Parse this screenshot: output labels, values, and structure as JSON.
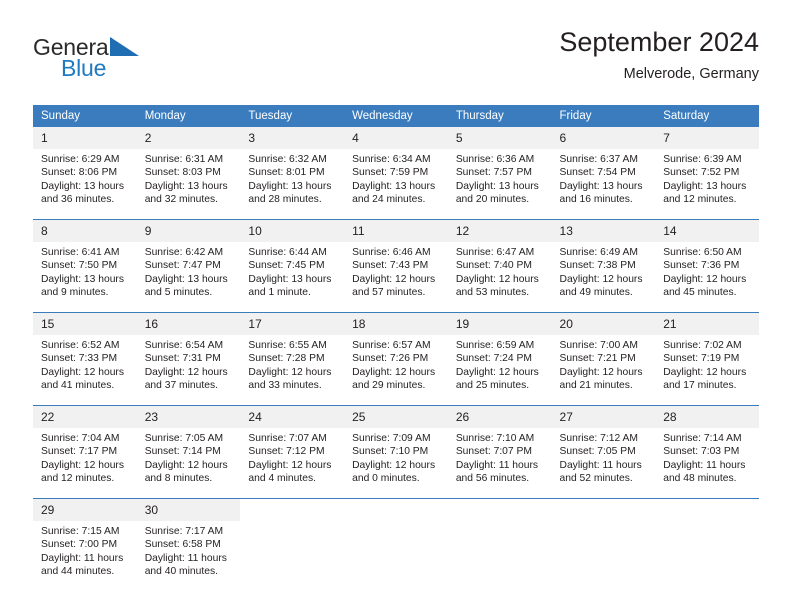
{
  "brand": {
    "name_part1": "General",
    "name_part2": "Blue",
    "triangle_color": "#1f6eb4",
    "blue_color": "#1f7bc1"
  },
  "header": {
    "title": "September 2024",
    "subtitle": "Melverode, Germany",
    "header_bg": "#3a7cbe",
    "daynum_bg": "#f1f1f1"
  },
  "weekday_headers": [
    "Sunday",
    "Monday",
    "Tuesday",
    "Wednesday",
    "Thursday",
    "Friday",
    "Saturday"
  ],
  "labels": {
    "sunrise_prefix": "Sunrise:",
    "sunset_prefix": "Sunset:",
    "daylight_prefix": "Daylight:"
  },
  "weeks": [
    [
      {
        "day": "1",
        "sunrise": "Sunrise: 6:29 AM",
        "sunset": "Sunset: 8:06 PM",
        "daylight_line1": "Daylight: 13 hours",
        "daylight_line2": "and 36 minutes."
      },
      {
        "day": "2",
        "sunrise": "Sunrise: 6:31 AM",
        "sunset": "Sunset: 8:03 PM",
        "daylight_line1": "Daylight: 13 hours",
        "daylight_line2": "and 32 minutes."
      },
      {
        "day": "3",
        "sunrise": "Sunrise: 6:32 AM",
        "sunset": "Sunset: 8:01 PM",
        "daylight_line1": "Daylight: 13 hours",
        "daylight_line2": "and 28 minutes."
      },
      {
        "day": "4",
        "sunrise": "Sunrise: 6:34 AM",
        "sunset": "Sunset: 7:59 PM",
        "daylight_line1": "Daylight: 13 hours",
        "daylight_line2": "and 24 minutes."
      },
      {
        "day": "5",
        "sunrise": "Sunrise: 6:36 AM",
        "sunset": "Sunset: 7:57 PM",
        "daylight_line1": "Daylight: 13 hours",
        "daylight_line2": "and 20 minutes."
      },
      {
        "day": "6",
        "sunrise": "Sunrise: 6:37 AM",
        "sunset": "Sunset: 7:54 PM",
        "daylight_line1": "Daylight: 13 hours",
        "daylight_line2": "and 16 minutes."
      },
      {
        "day": "7",
        "sunrise": "Sunrise: 6:39 AM",
        "sunset": "Sunset: 7:52 PM",
        "daylight_line1": "Daylight: 13 hours",
        "daylight_line2": "and 12 minutes."
      }
    ],
    [
      {
        "day": "8",
        "sunrise": "Sunrise: 6:41 AM",
        "sunset": "Sunset: 7:50 PM",
        "daylight_line1": "Daylight: 13 hours",
        "daylight_line2": "and 9 minutes."
      },
      {
        "day": "9",
        "sunrise": "Sunrise: 6:42 AM",
        "sunset": "Sunset: 7:47 PM",
        "daylight_line1": "Daylight: 13 hours",
        "daylight_line2": "and 5 minutes."
      },
      {
        "day": "10",
        "sunrise": "Sunrise: 6:44 AM",
        "sunset": "Sunset: 7:45 PM",
        "daylight_line1": "Daylight: 13 hours",
        "daylight_line2": "and 1 minute."
      },
      {
        "day": "11",
        "sunrise": "Sunrise: 6:46 AM",
        "sunset": "Sunset: 7:43 PM",
        "daylight_line1": "Daylight: 12 hours",
        "daylight_line2": "and 57 minutes."
      },
      {
        "day": "12",
        "sunrise": "Sunrise: 6:47 AM",
        "sunset": "Sunset: 7:40 PM",
        "daylight_line1": "Daylight: 12 hours",
        "daylight_line2": "and 53 minutes."
      },
      {
        "day": "13",
        "sunrise": "Sunrise: 6:49 AM",
        "sunset": "Sunset: 7:38 PM",
        "daylight_line1": "Daylight: 12 hours",
        "daylight_line2": "and 49 minutes."
      },
      {
        "day": "14",
        "sunrise": "Sunrise: 6:50 AM",
        "sunset": "Sunset: 7:36 PM",
        "daylight_line1": "Daylight: 12 hours",
        "daylight_line2": "and 45 minutes."
      }
    ],
    [
      {
        "day": "15",
        "sunrise": "Sunrise: 6:52 AM",
        "sunset": "Sunset: 7:33 PM",
        "daylight_line1": "Daylight: 12 hours",
        "daylight_line2": "and 41 minutes."
      },
      {
        "day": "16",
        "sunrise": "Sunrise: 6:54 AM",
        "sunset": "Sunset: 7:31 PM",
        "daylight_line1": "Daylight: 12 hours",
        "daylight_line2": "and 37 minutes."
      },
      {
        "day": "17",
        "sunrise": "Sunrise: 6:55 AM",
        "sunset": "Sunset: 7:28 PM",
        "daylight_line1": "Daylight: 12 hours",
        "daylight_line2": "and 33 minutes."
      },
      {
        "day": "18",
        "sunrise": "Sunrise: 6:57 AM",
        "sunset": "Sunset: 7:26 PM",
        "daylight_line1": "Daylight: 12 hours",
        "daylight_line2": "and 29 minutes."
      },
      {
        "day": "19",
        "sunrise": "Sunrise: 6:59 AM",
        "sunset": "Sunset: 7:24 PM",
        "daylight_line1": "Daylight: 12 hours",
        "daylight_line2": "and 25 minutes."
      },
      {
        "day": "20",
        "sunrise": "Sunrise: 7:00 AM",
        "sunset": "Sunset: 7:21 PM",
        "daylight_line1": "Daylight: 12 hours",
        "daylight_line2": "and 21 minutes."
      },
      {
        "day": "21",
        "sunrise": "Sunrise: 7:02 AM",
        "sunset": "Sunset: 7:19 PM",
        "daylight_line1": "Daylight: 12 hours",
        "daylight_line2": "and 17 minutes."
      }
    ],
    [
      {
        "day": "22",
        "sunrise": "Sunrise: 7:04 AM",
        "sunset": "Sunset: 7:17 PM",
        "daylight_line1": "Daylight: 12 hours",
        "daylight_line2": "and 12 minutes."
      },
      {
        "day": "23",
        "sunrise": "Sunrise: 7:05 AM",
        "sunset": "Sunset: 7:14 PM",
        "daylight_line1": "Daylight: 12 hours",
        "daylight_line2": "and 8 minutes."
      },
      {
        "day": "24",
        "sunrise": "Sunrise: 7:07 AM",
        "sunset": "Sunset: 7:12 PM",
        "daylight_line1": "Daylight: 12 hours",
        "daylight_line2": "and 4 minutes."
      },
      {
        "day": "25",
        "sunrise": "Sunrise: 7:09 AM",
        "sunset": "Sunset: 7:10 PM",
        "daylight_line1": "Daylight: 12 hours",
        "daylight_line2": "and 0 minutes."
      },
      {
        "day": "26",
        "sunrise": "Sunrise: 7:10 AM",
        "sunset": "Sunset: 7:07 PM",
        "daylight_line1": "Daylight: 11 hours",
        "daylight_line2": "and 56 minutes."
      },
      {
        "day": "27",
        "sunrise": "Sunrise: 7:12 AM",
        "sunset": "Sunset: 7:05 PM",
        "daylight_line1": "Daylight: 11 hours",
        "daylight_line2": "and 52 minutes."
      },
      {
        "day": "28",
        "sunrise": "Sunrise: 7:14 AM",
        "sunset": "Sunset: 7:03 PM",
        "daylight_line1": "Daylight: 11 hours",
        "daylight_line2": "and 48 minutes."
      }
    ],
    [
      {
        "day": "29",
        "sunrise": "Sunrise: 7:15 AM",
        "sunset": "Sunset: 7:00 PM",
        "daylight_line1": "Daylight: 11 hours",
        "daylight_line2": "and 44 minutes."
      },
      {
        "day": "30",
        "sunrise": "Sunrise: 7:17 AM",
        "sunset": "Sunset: 6:58 PM",
        "daylight_line1": "Daylight: 11 hours",
        "daylight_line2": "and 40 minutes."
      },
      {
        "day": "",
        "sunrise": "",
        "sunset": "",
        "daylight_line1": "",
        "daylight_line2": ""
      },
      {
        "day": "",
        "sunrise": "",
        "sunset": "",
        "daylight_line1": "",
        "daylight_line2": ""
      },
      {
        "day": "",
        "sunrise": "",
        "sunset": "",
        "daylight_line1": "",
        "daylight_line2": ""
      },
      {
        "day": "",
        "sunrise": "",
        "sunset": "",
        "daylight_line1": "",
        "daylight_line2": ""
      },
      {
        "day": "",
        "sunrise": "",
        "sunset": "",
        "daylight_line1": "",
        "daylight_line2": ""
      }
    ]
  ]
}
